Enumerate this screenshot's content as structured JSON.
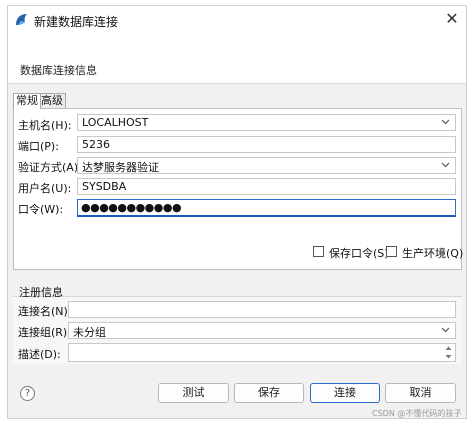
{
  "window": {
    "title": "新建数据库连接",
    "header_title": "数据库连接信息"
  },
  "tabs": [
    {
      "label": "常规",
      "active": true
    },
    {
      "label": "高级",
      "active": false
    }
  ],
  "form": {
    "host": {
      "label": "主机名(H):",
      "value": "LOCALHOST"
    },
    "port": {
      "label": "端口(P):",
      "value": "5236"
    },
    "auth": {
      "label": "验证方式(A):",
      "value": "达梦服务器验证"
    },
    "user": {
      "label": "用户名(U):",
      "value": "SYSDBA"
    },
    "password": {
      "label": "口令(W):",
      "value": "●●●●●●●●●●●"
    },
    "save_password": {
      "label": "保存口令(S)",
      "checked": false
    },
    "production_env": {
      "label": "生产环境(Q)",
      "checked": false
    }
  },
  "registration": {
    "title": "注册信息",
    "conn_name": {
      "label": "连接名(N):",
      "value": ""
    },
    "conn_group": {
      "label": "连接组(R):",
      "value": "未分组"
    },
    "description": {
      "label": "描述(D):",
      "value": ""
    }
  },
  "buttons": {
    "help": "?",
    "test": "测试",
    "save": "保存",
    "connect": "连接",
    "cancel": "取消"
  },
  "watermark": "CSDN @不懂代码的孩子",
  "colors": {
    "accent_border": "#2b6ccf",
    "window_bg": "#f1f1f1"
  }
}
